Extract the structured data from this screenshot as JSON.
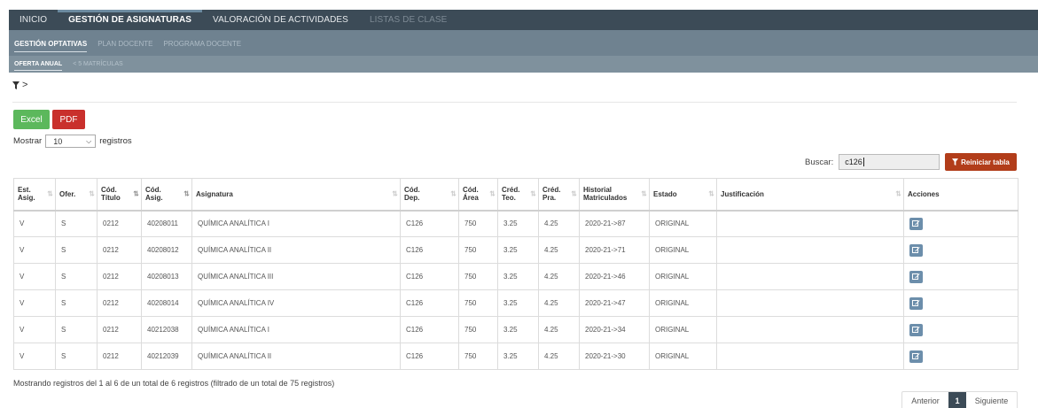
{
  "nav": {
    "tabs": [
      "INICIO",
      "GESTIÓN DE ASIGNATURAS",
      "VALORACIÓN DE ACTIVIDADES",
      "LISTAS DE CLASE"
    ]
  },
  "subnav": {
    "tabs": [
      "GESTIÓN OPTATIVAS",
      "PLAN DOCENTE",
      "PROGRAMA DOCENTE"
    ]
  },
  "subnav2": {
    "tabs": [
      "OFERTA ANUAL",
      "< 5 MATRÍCULAS"
    ]
  },
  "filter": {
    "chevron": ">"
  },
  "export": {
    "excel_label": "Excel",
    "pdf_label": "PDF"
  },
  "length": {
    "prefix": "Mostrar",
    "value": "10",
    "suffix": "registros"
  },
  "search": {
    "label": "Buscar:",
    "value": "c126"
  },
  "reset_label": "Reiniciar tabla",
  "table": {
    "headers": [
      "Est.\nAsig.",
      "Ofer.",
      "Cód.\nTítulo",
      "Cód.\nAsig.",
      "Asignatura",
      "Cód.\nDep.",
      "Cód.\nÁrea",
      "Créd.\nTeo.",
      "Créd.\nPra.",
      "Historial\nMatriculados",
      "Estado",
      "Justificación",
      "Acciones"
    ],
    "rows": [
      [
        "V",
        "S",
        "0212",
        "40208011",
        "QUÍMICA ANALÍTICA I",
        "C126",
        "750",
        "3.25",
        "4.25",
        "2020-21->87",
        "ORIGINAL",
        ""
      ],
      [
        "V",
        "S",
        "0212",
        "40208012",
        "QUÍMICA ANALÍTICA II",
        "C126",
        "750",
        "3.25",
        "4.25",
        "2020-21->71",
        "ORIGINAL",
        ""
      ],
      [
        "V",
        "S",
        "0212",
        "40208013",
        "QUÍMICA ANALÍTICA III",
        "C126",
        "750",
        "3.25",
        "4.25",
        "2020-21->46",
        "ORIGINAL",
        ""
      ],
      [
        "V",
        "S",
        "0212",
        "40208014",
        "QUÍMICA ANALÍTICA IV",
        "C126",
        "750",
        "3.25",
        "4.25",
        "2020-21->47",
        "ORIGINAL",
        ""
      ],
      [
        "V",
        "S",
        "0212",
        "40212038",
        "QUÍMICA ANALÍTICA I",
        "C126",
        "750",
        "3.25",
        "4.25",
        "2020-21->34",
        "ORIGINAL",
        ""
      ],
      [
        "V",
        "S",
        "0212",
        "40212039",
        "QUÍMICA ANALÍTICA II",
        "C126",
        "750",
        "3.25",
        "4.25",
        "2020-21->30",
        "ORIGINAL",
        ""
      ]
    ]
  },
  "info": "Mostrando registros del 1 al 6 de un total de 6 registros (filtrado de un total de 75 registros)",
  "pager": {
    "prev": "Anterior",
    "current": "1",
    "next": "Siguiente"
  },
  "colors": {
    "nav_dark": "#3c4b57",
    "excel": "#5cb85c",
    "pdf": "#c9302c",
    "reset": "#b23d1a",
    "edit": "#6c8eab"
  }
}
